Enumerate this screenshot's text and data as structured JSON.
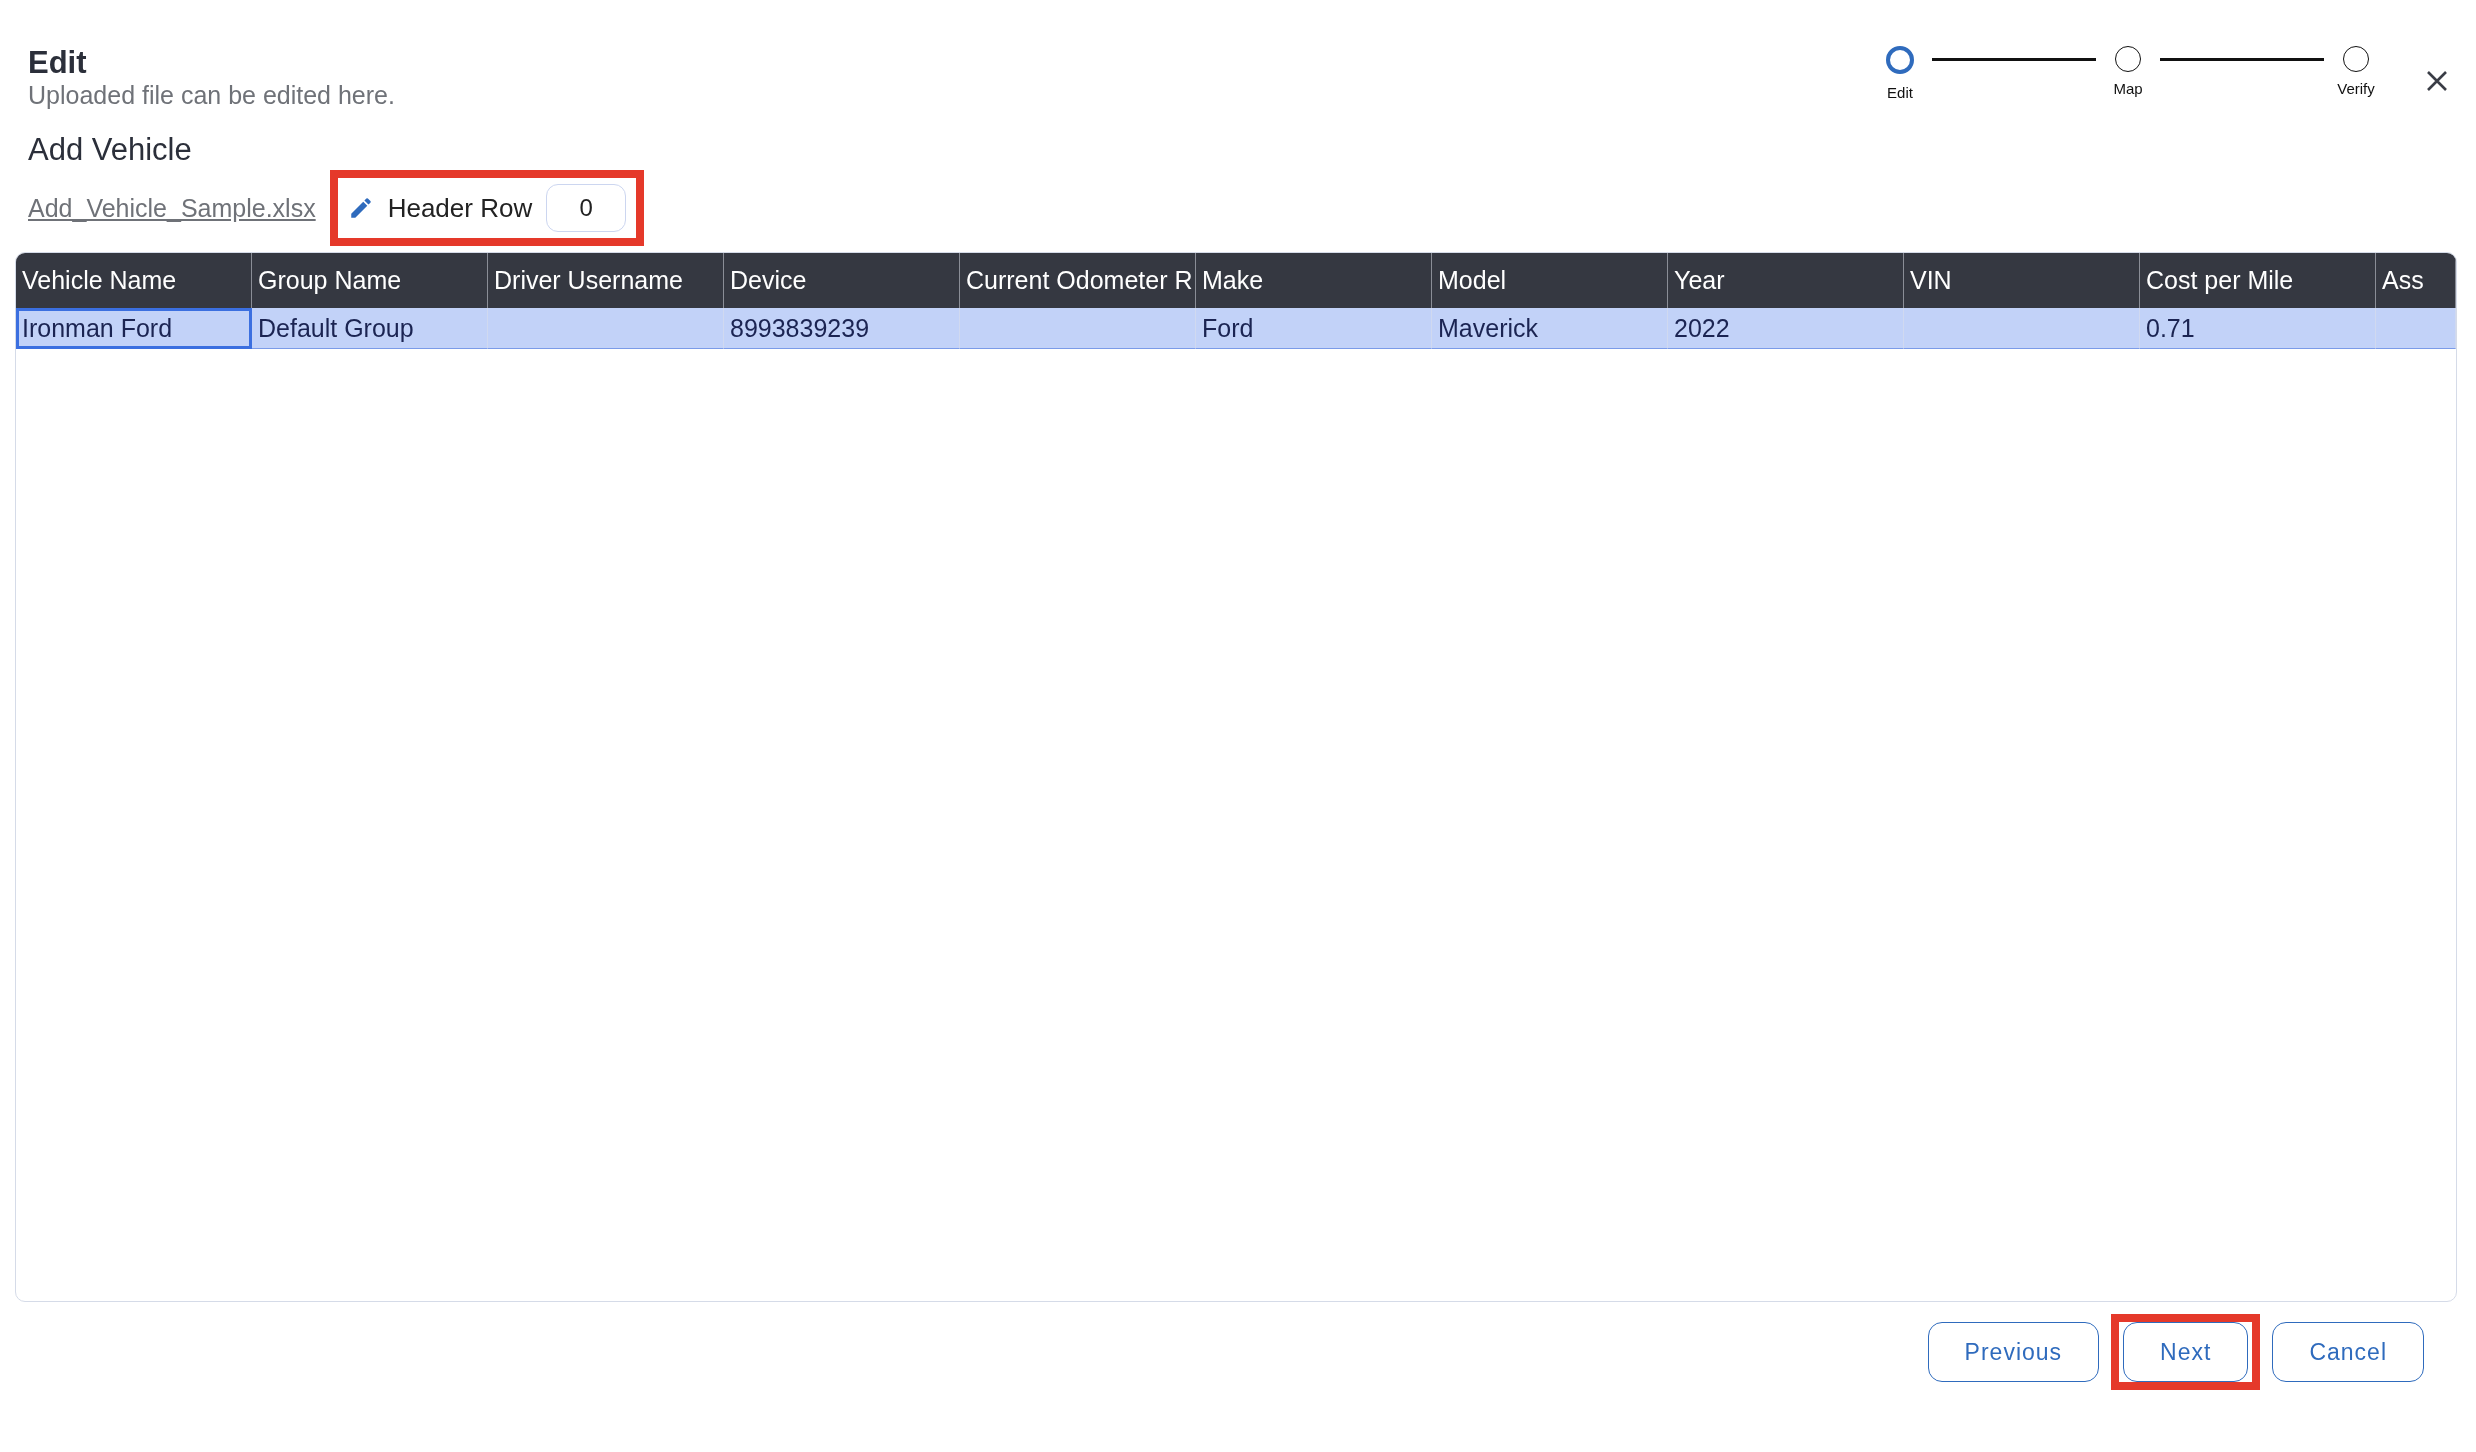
{
  "dialog": {
    "title": "Edit",
    "subtitle": "Uploaded file can be edited here."
  },
  "steps": [
    {
      "label": "Edit",
      "selected": true
    },
    {
      "label": "Map",
      "selected": false
    },
    {
      "label": "Verify",
      "selected": false
    }
  ],
  "section_title": "Add Vehicle",
  "file_link": "Add_Vehicle_Sample.xlsx",
  "header_row": {
    "label": "Header Row",
    "value": "0",
    "highlighted": true
  },
  "table": {
    "columns": [
      "Vehicle Name",
      "Group Name",
      "Driver Username",
      "Device",
      "Current Odometer R",
      "Make",
      "Model",
      "Year",
      "VIN",
      "Cost per Mile",
      "Ass"
    ],
    "rows": [
      {
        "selected": true,
        "cells": [
          {
            "text": "Ironman Ford",
            "selected": true
          },
          {
            "text": "Default Group",
            "selected": false
          },
          {
            "selected": false
          },
          {
            "text": "8993839239",
            "selected": false
          },
          {
            "selected": false
          },
          {
            "text": "Ford",
            "selected": false
          },
          {
            "text": "Maverick",
            "selected": false
          },
          {
            "text": "2022",
            "selected": false
          },
          {
            "selected": false
          },
          {
            "text": "0.71",
            "selected": false
          },
          {
            "selected": false
          }
        ]
      }
    ]
  },
  "buttons": [
    {
      "label": "Previous",
      "highlighted": false
    },
    {
      "label": "Next",
      "highlighted": true
    },
    {
      "label": "Cancel",
      "highlighted": false
    }
  ]
}
